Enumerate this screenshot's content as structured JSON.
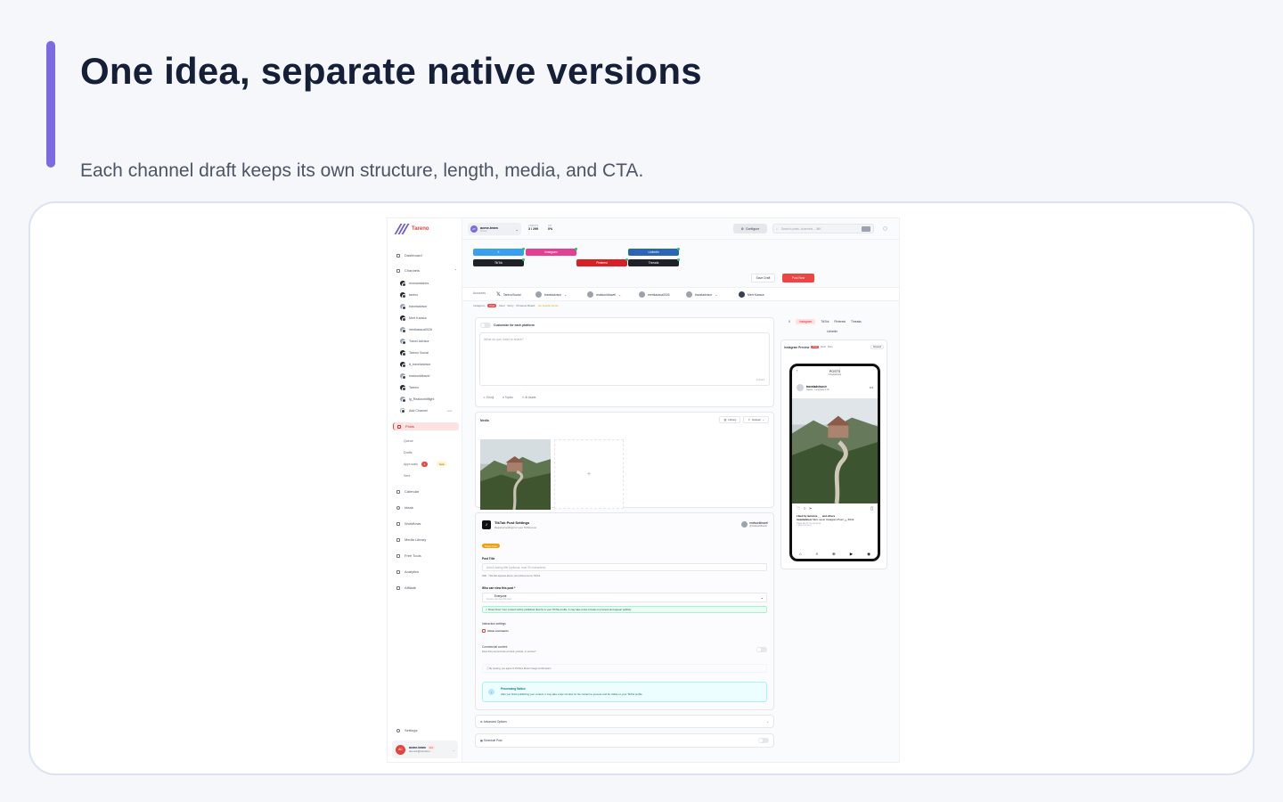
{
  "hero": {
    "title": "One idea, separate native versions",
    "subtitle": "Each channel draft keeps its own structure, length, media, and CTA."
  },
  "colors": {
    "accent": "#7c6be0",
    "brand_red": "#ef4444",
    "title": "#152038"
  },
  "app": {
    "brand": "Tareno",
    "sidebar": {
      "dashboard": "Dashboard",
      "channels": "Channels",
      "channel_list": [
        "monowatches",
        "tareno",
        "traveladvisor",
        "Mert Karaca",
        "mertkaraca0026",
        "Travel Advisor",
        "Tareno Social",
        "tt_traveladvisor",
        "realworldtravel",
        "Tareno",
        "ig_Realworldflight"
      ],
      "add_channel": "Add Channel",
      "add_hint": "new",
      "posts": "Posts",
      "posts_sub": [
        "Queue",
        "Drafts",
        "Approvals",
        "Sent"
      ],
      "approvals_badge": "2",
      "approvals_tag": "beta",
      "items": [
        "Calendar",
        "Ideas",
        "Workflows",
        "Media Library",
        "Free Tools",
        "Analytics",
        "Affiliate"
      ],
      "settings": "Settings",
      "user": {
        "initials": "AC",
        "name": "acme-team",
        "plan": "Pro",
        "email": "tareno1@hotmail.c..."
      }
    },
    "topbar": {
      "team": "acme-team",
      "team_initials": "AT",
      "team_role": "Owner",
      "credits_label": "CREDITS",
      "credits_value": "3 / 299",
      "api_label": "API",
      "api_value": "0%",
      "configure": "Configure",
      "search_placeholder": "Search posts, channels... ⌘K"
    },
    "platforms": [
      "X",
      "Instagram",
      "LinkedIn",
      "TikTok",
      "Pinterest",
      "Threads"
    ],
    "save_draft": "Save Draft",
    "post_now": "Post Now",
    "accounts_label": "Accounts",
    "accounts": [
      "TarenoSocial",
      "traveladvisor",
      "realworldtravel",
      "mertkaraca0026",
      "traveladvisor",
      "Mert Karaca"
    ],
    "format_row": {
      "label": "Instagram",
      "options": [
        "Post",
        "Reel",
        "Story"
      ],
      "board_label": "Pinterest Board:",
      "board_value": "No boards found"
    },
    "composer": {
      "customize": "Customize for each platform",
      "placeholder": "What do you want to share?",
      "chars": "0 chars",
      "tools": [
        "Emoji",
        "Topics",
        "AI Assist"
      ]
    },
    "media": {
      "title": "Media",
      "library": "Library",
      "upload": "Upload",
      "add": "+"
    },
    "tiktok": {
      "title": "TikTok Post Settings",
      "subtitle": "Required settings for your TikTok post",
      "account": "realworldtravel",
      "handle": "@realworldtravel",
      "photo_badge": "Photo Post",
      "post_title_label": "Post Title",
      "post_title_placeholder": "Add a catchy title (optional, max 90 characters)",
      "post_title_hint": "0/90 · This title appears above your photo post on TikTok",
      "who_label": "Who can view this post *",
      "who_value": "Everyone",
      "who_hint": "Anyone can view this post",
      "direct_post": "Direct Post: Your content will be published directly to your TikTok profile. It may take a few minutes to process and appear publicly.",
      "interaction_label": "Interaction settings",
      "allow_comments": "Allow comments",
      "commercial_label": "Commercial content",
      "commercial_hint": "Does this post promote a brand, product, or service?",
      "agree_text": "By posting, you agree to TikTok's Music Usage Confirmation",
      "processing_title": "Processing Notice",
      "processing_text": "After you finish publishing your content, it may take a few minutes for the content to process and be visible on your TikTok profile."
    },
    "advanced": "Advanced Options",
    "schedule": "Schedule Post",
    "preview": {
      "tabs": [
        "X",
        "Instagram",
        "TikTok",
        "Pinterest",
        "Threads",
        "LinkedIn"
      ],
      "title": "Instagram Preview",
      "modes": [
        "Post",
        "Reel",
        "Story"
      ],
      "expand": "Expand",
      "header": "POSTS",
      "header_sub": "traveladvisor",
      "user": "traveladvisor.tr",
      "user_sub": "Cassie · Long May 2 On",
      "liked": "Liked by lamvone___ and others",
      "caption_user": "traveladvisor",
      "caption": "Mein neuer Instagram Post! 🏔️ #viral",
      "comments": "View all 47 comments",
      "time": "2 MINUTES AGO"
    }
  }
}
